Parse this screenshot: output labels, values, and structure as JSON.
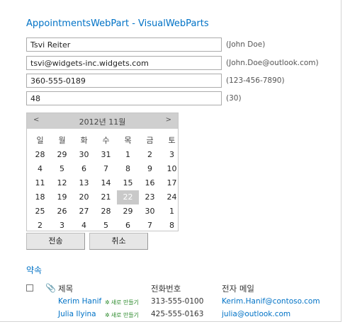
{
  "webpart": {
    "title": "AppointmentsWebPart - VisualWebParts"
  },
  "form": {
    "name_value": "Tsvi Reiter",
    "name_hint": "(John Doe)",
    "email_value": "tsvi@widgets-inc.widgets.com",
    "email_hint": "(John.Doe@outlook.com)",
    "phone_value": "360-555-0189",
    "phone_hint": "(123-456-7890)",
    "age_value": "48",
    "age_hint": "(30)"
  },
  "calendar": {
    "prev": "<",
    "next": ">",
    "month_label": "2012년 11월",
    "weekdays": [
      "일",
      "월",
      "화",
      "수",
      "목",
      "금",
      "토"
    ],
    "weeks": [
      [
        "28",
        "29",
        "30",
        "31",
        "1",
        "2",
        "3"
      ],
      [
        "4",
        "5",
        "6",
        "7",
        "8",
        "9",
        "10"
      ],
      [
        "11",
        "12",
        "13",
        "14",
        "15",
        "16",
        "17"
      ],
      [
        "18",
        "19",
        "20",
        "21",
        "22",
        "23",
        "24"
      ],
      [
        "25",
        "26",
        "27",
        "28",
        "29",
        "30",
        "1"
      ],
      [
        "2",
        "3",
        "4",
        "5",
        "6",
        "7",
        "8"
      ]
    ],
    "selected_day": "22"
  },
  "buttons": {
    "submit": "전송",
    "cancel": "취소"
  },
  "appointments": {
    "title": "약속",
    "columns": {
      "title": "제목",
      "phone": "전화번호",
      "email": "전자 메일"
    },
    "new_badge": "새로 만들기",
    "rows": [
      {
        "name": "Kerim Hanif",
        "phone": "313-555-0100",
        "email": "Kerim.Hanif@contoso.com"
      },
      {
        "name": "Julia Ilyina",
        "phone": "425-555-0163",
        "email": "julia@outlook.com"
      }
    ]
  }
}
